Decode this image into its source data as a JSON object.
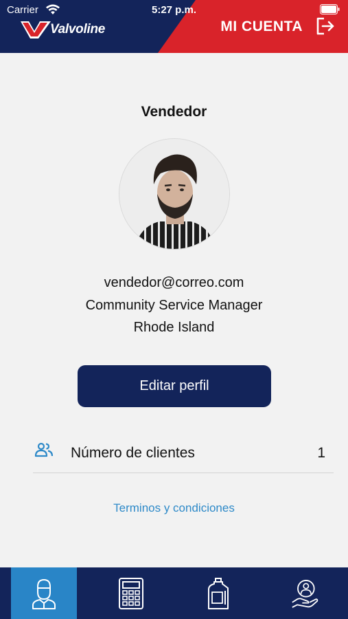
{
  "status_bar": {
    "carrier": "Carrier",
    "time": "5:27 p.m."
  },
  "header": {
    "brand": "Valvoline",
    "title": "MI CUENTA",
    "logout_icon": "logout-icon"
  },
  "profile": {
    "role": "Vendedor",
    "email": "vendedor@correo.com",
    "position": "Community Service Manager",
    "location": "Rhode Island",
    "edit_button": "Editar perfil"
  },
  "clients": {
    "label": "Número de clientes",
    "count": "1",
    "icon": "people-icon"
  },
  "terms_link": "Terminos y condiciones",
  "bottom_nav": [
    {
      "name": "profile",
      "icon": "person-icon",
      "active": true
    },
    {
      "name": "calculator",
      "icon": "calculator-icon",
      "active": false
    },
    {
      "name": "products",
      "icon": "oil-bottle-icon",
      "active": false
    },
    {
      "name": "support",
      "icon": "hand-service-icon",
      "active": false
    }
  ],
  "colors": {
    "navy": "#13245a",
    "red": "#d9232a",
    "accent_blue": "#2985c7",
    "link": "#2d89c8",
    "background": "#f2f2f2"
  }
}
